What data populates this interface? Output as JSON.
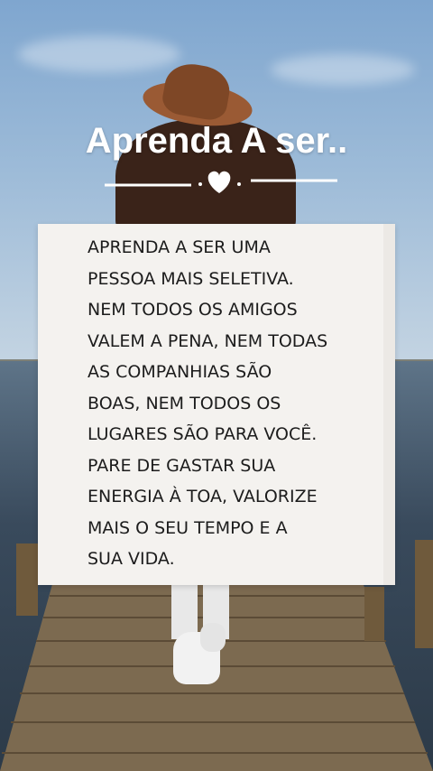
{
  "title": "Aprenda A ser..",
  "quote": "APRENDA A SER UMA\nPESSOA MAIS SELETIVA.\nNEM TODOS OS AMIGOS\nVALEM A PENA, NEM TODAS\nAS COMPANHIAS SÃO\nBOAS, NEM TODOS OS\nLUGARES SÃO PARA VOCÊ.\nPARE DE GASTAR SUA\nENERGIA À TOA, VALORIZE\nMAIS O SEU TEMPO E A\nSUA VIDA.",
  "colors": {
    "title_text": "#ffffff",
    "card_background": "#f4f2ef",
    "quote_text": "#1c1c1c",
    "hat": "#9a5a34",
    "sky": "#9dbbd8"
  },
  "icons": [
    "heart-icon"
  ]
}
